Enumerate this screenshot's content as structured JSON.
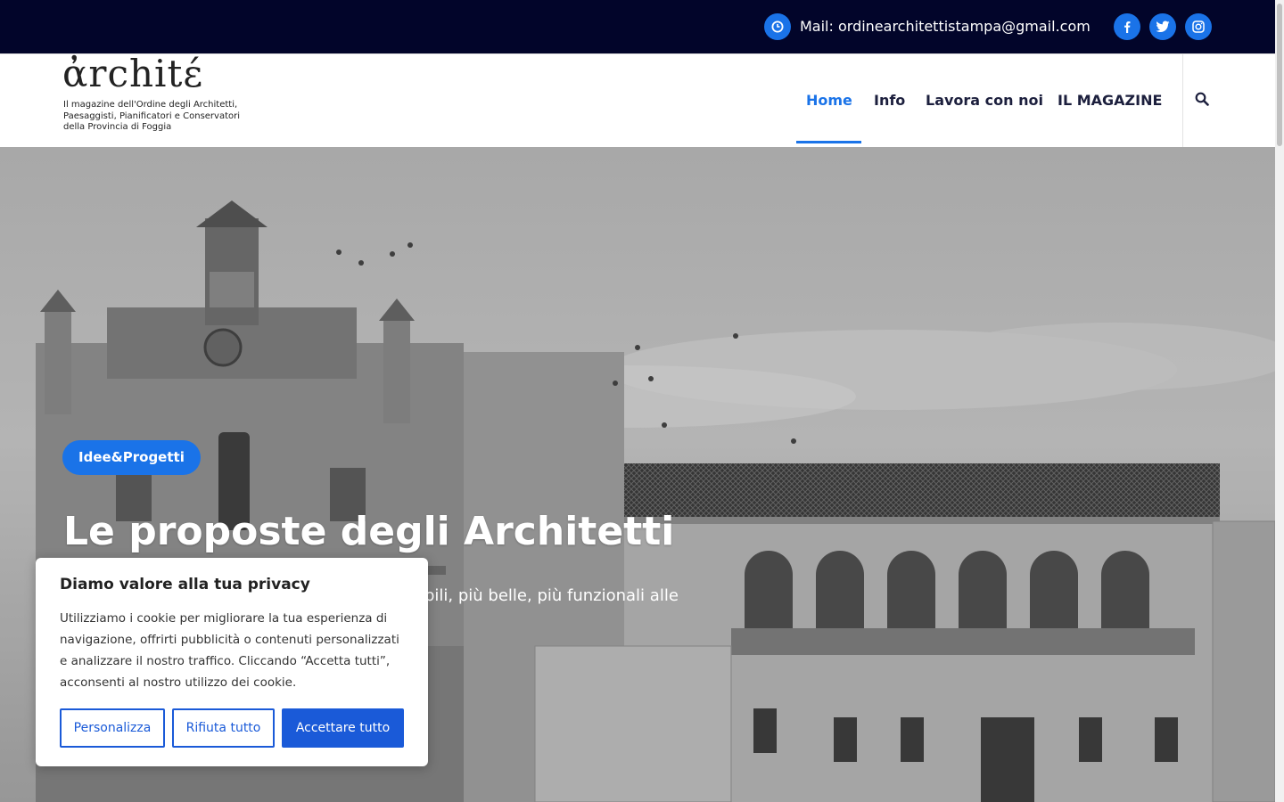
{
  "topbar": {
    "mail_text": "Mail: ordinearchitettistampa@gmail.com",
    "social": [
      "facebook-icon",
      "twitter-icon",
      "instagram-icon"
    ],
    "accent": "#1a73e8",
    "background": "#02052a"
  },
  "header": {
    "logo_text": "ἀrchitέ",
    "tagline": "Il magazine dell'Ordine degli Architetti, Paesaggisti, Pianificatori e Conservatori della Provincia di Foggia",
    "nav": [
      {
        "label": "Home",
        "active": true
      },
      {
        "label": "Info",
        "active": false
      },
      {
        "label": "Lavora con noi",
        "active": false
      },
      {
        "label": "IL MAGAZINE",
        "active": false
      }
    ]
  },
  "hero": {
    "category": "Idee&Progetti",
    "title": "Le proposte degli Architetti",
    "subtitle_visible": "ibili, più belle, più funzionali alle"
  },
  "cookie": {
    "title": "Diamo valore alla tua privacy",
    "text": "Utilizziamo i cookie per migliorare la tua esperienza di navigazione, offrirti pubblicità o contenuti personalizzati e analizzare il nostro traffico. Cliccando “Accetta tutti”, acconsenti al nostro utilizzo dei cookie.",
    "buttons": {
      "customize": "Personalizza",
      "reject": "Rifiuta tutto",
      "accept": "Accettare tutto"
    }
  }
}
